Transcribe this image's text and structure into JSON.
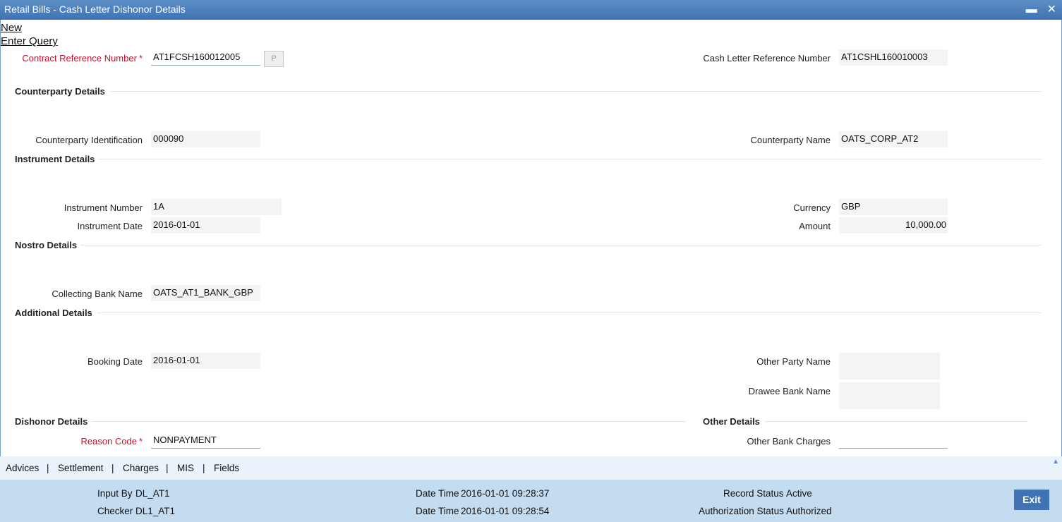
{
  "window": {
    "title": "Retail Bills - Cash Letter Dishonor Details",
    "minimize": "▬",
    "close": "✕"
  },
  "menu": {
    "new": "New",
    "enter_query": "Enter Query"
  },
  "header": {
    "contract_ref_label": "Contract Reference Number",
    "contract_ref_value": "AT1FCSH160012005",
    "p_button": "P",
    "cash_letter_ref_label": "Cash Letter Reference Number",
    "cash_letter_ref_value": "AT1CSHL160010003"
  },
  "counterparty": {
    "heading": "Counterparty Details",
    "id_label": "Counterparty Identification",
    "id_value": "000090",
    "name_label": "Counterparty Name",
    "name_value": "OATS_CORP_AT2"
  },
  "instrument": {
    "heading": "Instrument Details",
    "number_label": "Instrument Number",
    "number_value": "1A",
    "date_label": "Instrument Date",
    "date_value": "2016-01-01",
    "currency_label": "Currency",
    "currency_value": "GBP",
    "amount_label": "Amount",
    "amount_value": "10,000.00"
  },
  "nostro": {
    "heading": "Nostro Details",
    "bank_label": "Collecting Bank Name",
    "bank_value": "OATS_AT1_BANK_GBP"
  },
  "additional": {
    "heading": "Additional Details",
    "booking_label": "Booking Date",
    "booking_value": "2016-01-01",
    "other_party_label": "Other Party Name",
    "other_party_value": "",
    "drawee_label": "Drawee Bank Name",
    "drawee_value": ""
  },
  "dishonor": {
    "heading": "Dishonor Details",
    "reason_label": "Reason Code",
    "reason_value": "NONPAYMENT"
  },
  "other": {
    "heading": "Other Details",
    "charges_label": "Other Bank Charges",
    "charges_value": ""
  },
  "tabs": [
    "Advices",
    "Settlement",
    "Charges",
    "MIS",
    "Fields"
  ],
  "tab_separator": "|",
  "footer": {
    "input_by_label": "Input By",
    "input_by_value": "DL_AT1",
    "checker_label": "Checker",
    "checker_value": "DL1_AT1",
    "datetime_label": "Date Time",
    "input_datetime": "2016-01-01 09:28:37",
    "checker_datetime": "2016-01-01 09:28:54",
    "record_status_label": "Record Status",
    "record_status_value": "Active",
    "auth_status_label": "Authorization Status",
    "auth_status_value": "Authorized",
    "exit_label": "Exit"
  },
  "colors": {
    "title_bar": "#3f73b3",
    "required_label": "#c8102e",
    "footer_bg": "#c3dcf0",
    "tabs_bg": "#eaf3fb"
  }
}
